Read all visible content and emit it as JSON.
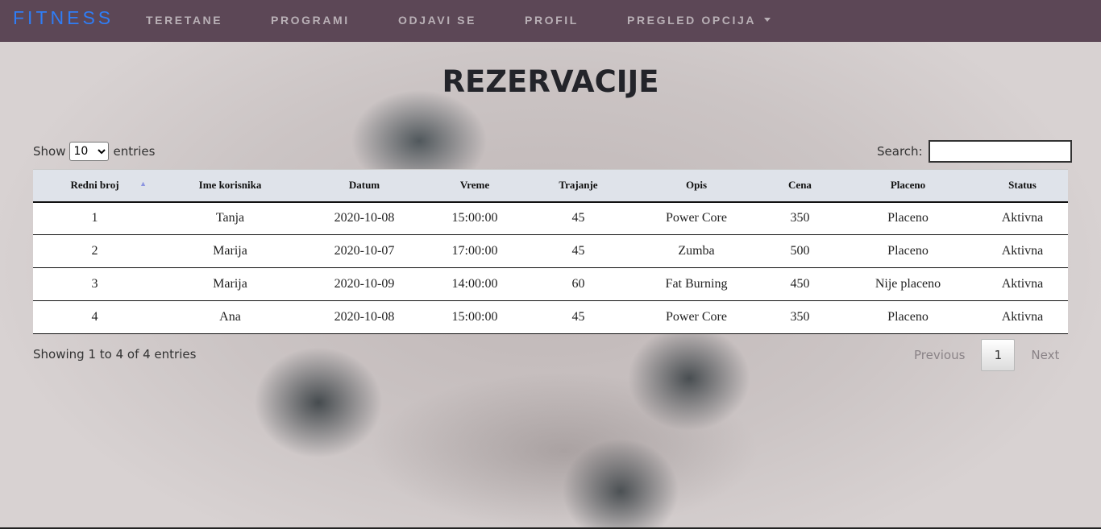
{
  "nav": {
    "brand": "FITNESS",
    "links": [
      "TERETANE",
      "PROGRAMI",
      "ODJAVI SE",
      "PROFIL",
      "PREGLED OPCIJA"
    ]
  },
  "page": {
    "title": "REZERVACIJE"
  },
  "controls": {
    "show_label": "Show",
    "entries_label": "entries",
    "page_length": "10",
    "search_label": "Search:",
    "search_value": ""
  },
  "table": {
    "columns": [
      "Redni broj",
      "Ime korisnika",
      "Datum",
      "Vreme",
      "Trajanje",
      "Opis",
      "Cena",
      "Placeno",
      "Status"
    ],
    "sorted_column": "Redni broj",
    "sort_direction": "ascending",
    "rows": [
      [
        "1",
        "Tanja",
        "2020-10-08",
        "15:00:00",
        "45",
        "Power Core",
        "350",
        "Placeno",
        "Aktivna"
      ],
      [
        "2",
        "Marija",
        "2020-10-07",
        "17:00:00",
        "45",
        "Zumba",
        "500",
        "Placeno",
        "Aktivna"
      ],
      [
        "3",
        "Marija",
        "2020-10-09",
        "14:00:00",
        "60",
        "Fat Burning",
        "450",
        "Nije placeno",
        "Aktivna"
      ],
      [
        "4",
        "Ana",
        "2020-10-08",
        "15:00:00",
        "45",
        "Power Core",
        "350",
        "Placeno",
        "Aktivna"
      ]
    ]
  },
  "footer": {
    "info": "Showing 1 to 4 of 4 entries",
    "previous": "Previous",
    "current_page": "1",
    "next": "Next"
  },
  "colors": {
    "navbar": "#5c4756",
    "brand": "#2f7df6",
    "nav_link": "#b9b0b6",
    "header_row": "#dfe3ea"
  }
}
